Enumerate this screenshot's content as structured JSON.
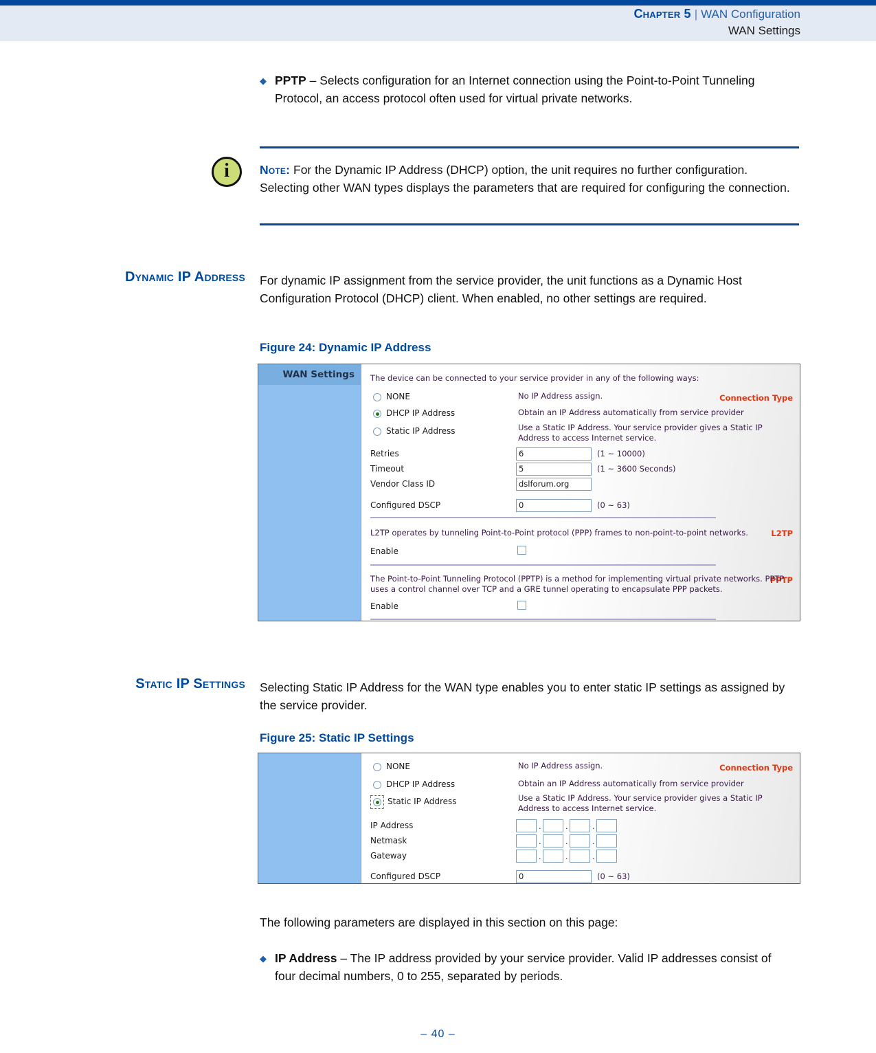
{
  "header": {
    "chapter": "Chapter 5",
    "separator": "|",
    "doc_title": "WAN Configuration",
    "section": "WAN Settings"
  },
  "bullets": {
    "pptp": {
      "term": "PPTP",
      "dash": " – ",
      "text": "Selects configuration for an Internet connection using the Point-to-Point Tunneling Protocol, an access protocol often used for virtual private networks."
    },
    "ip_address": {
      "term": "IP Address",
      "dash": " – ",
      "text": "The IP address provided by your service provider. Valid IP addresses consist of four decimal numbers, 0 to 255, separated by periods."
    }
  },
  "note": {
    "icon": "info-icon",
    "label": "Note:",
    "text": " For the Dynamic IP Address (DHCP) option, the unit requires no further configuration. Selecting other WAN types displays the parameters that are required for configuring the connection."
  },
  "sections": {
    "dynamic_ip": {
      "heading": "Dynamic IP Address",
      "body": "For dynamic IP assignment from the service provider, the unit functions as a Dynamic Host Configuration Protocol (DHCP) client. When enabled, no other settings are required.",
      "figure_caption": "Figure 24:  Dynamic IP Address"
    },
    "static_ip": {
      "heading": "Static IP Settings",
      "body": "Selecting Static IP Address for the WAN type enables you to enter static IP settings as assigned by the service provider.",
      "figure_caption": "Figure 25:  Static IP Settings"
    }
  },
  "intro_params": "The following parameters are displayed in this section on this page:",
  "figure24": {
    "panel_title": "WAN Settings",
    "panel_connection_type": "Connection Type",
    "panel_l2tp": "L2TP",
    "panel_pptp": "PPTP",
    "intro": "The device can be connected to your service provider in any of the following ways:",
    "options": [
      {
        "label": "NONE",
        "description": "No IP Address assign.",
        "selected": false
      },
      {
        "label": "DHCP IP Address",
        "description": "Obtain an IP Address automatically from service provider",
        "selected": true
      },
      {
        "label": "Static IP Address",
        "description": "Use a Static IP Address. Your service provider gives a Static IP Address to access Internet service.",
        "selected": false
      }
    ],
    "fields": [
      {
        "label": "Retries",
        "value": "6",
        "hint": "(1 ~ 10000)"
      },
      {
        "label": "Timeout",
        "value": "5",
        "hint": "(1 ~ 3600 Seconds)"
      },
      {
        "label": "Vendor Class ID",
        "value": "dslforum.org",
        "hint": ""
      },
      {
        "label": "Configured DSCP",
        "value": "0",
        "hint": "(0 ~ 63)"
      }
    ],
    "l2tp": {
      "description": "L2TP operates by tunneling Point-to-Point protocol (PPP) frames to non-point-to-point networks.",
      "enable_label": "Enable",
      "enabled": false
    },
    "pptp": {
      "description": "The Point-to-Point Tunneling Protocol (PPTP) is a method for implementing virtual private networks. PPTP uses a control channel over TCP and a GRE tunnel operating to encapsulate PPP packets.",
      "enable_label": "Enable",
      "enabled": false
    }
  },
  "figure25": {
    "panel_connection_type": "Connection Type",
    "options": [
      {
        "label": "NONE",
        "description": "No IP Address assign.",
        "selected": false
      },
      {
        "label": "DHCP IP Address",
        "description": "Obtain an IP Address automatically from service provider",
        "selected": false
      },
      {
        "label": "Static IP Address",
        "description": "Use a Static IP Address. Your service provider gives a Static IP Address to access Internet service.",
        "selected": true
      }
    ],
    "ip_fields": [
      {
        "label": "IP Address",
        "octets": [
          "",
          "",
          "",
          ""
        ]
      },
      {
        "label": "Netmask",
        "octets": [
          "",
          "",
          "",
          ""
        ]
      },
      {
        "label": "Gateway",
        "octets": [
          "",
          "",
          "",
          ""
        ]
      }
    ],
    "dscp": {
      "label": "Configured DSCP",
      "value": "0",
      "hint": "(0 ~ 63)"
    }
  },
  "footer": {
    "page": "–  40  –"
  },
  "colors": {
    "accent_blue": "#00499c",
    "header_band": "#e4eaf4",
    "panel_blue": "#8fc0ef",
    "panel_blue_dark": "#79aee0",
    "panel_label_red": "#e8360f",
    "note_icon_green": "#ccdd77"
  }
}
